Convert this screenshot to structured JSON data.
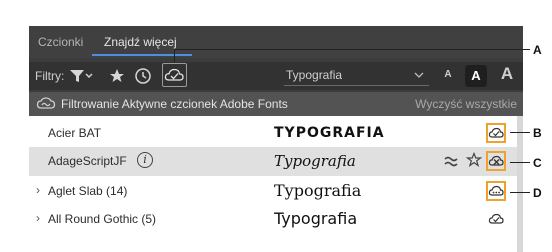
{
  "tabs": [
    {
      "label": "Czcionki"
    },
    {
      "label": "Znajdź więcej"
    }
  ],
  "filterbar": {
    "filters_label": "Filtry:",
    "preview_text": "Typografia",
    "size_small": "A",
    "size_medium": "A",
    "size_large": "A"
  },
  "banner": {
    "text": "Filtrowanie Aktywne czcionek Adobe Fonts",
    "clear": "Wyczyść wszystkie"
  },
  "fonts": [
    {
      "name": "Acier BAT",
      "preview": "TYPOGRAFIA",
      "expandable": false,
      "action": "activated-cloud-icon"
    },
    {
      "name": "AdageScriptJF",
      "preview": "Typografia",
      "expandable": false,
      "action": "deactivate-cloud-icon"
    },
    {
      "name": "Aglet Slab (14)",
      "preview": "Typografia",
      "expandable": true,
      "action": "partial-cloud-icon"
    },
    {
      "name": "All Round Gothic (5)",
      "preview": "Typografia",
      "expandable": true,
      "action": "activated-cloud-icon"
    }
  ],
  "callouts": [
    "A",
    "B",
    "C",
    "D"
  ],
  "colors": {
    "accent_tab": "#4a8fe0",
    "highlight_box": "#f0a22e",
    "panel_dark": "#3c3c3c",
    "banner": "#535353"
  }
}
